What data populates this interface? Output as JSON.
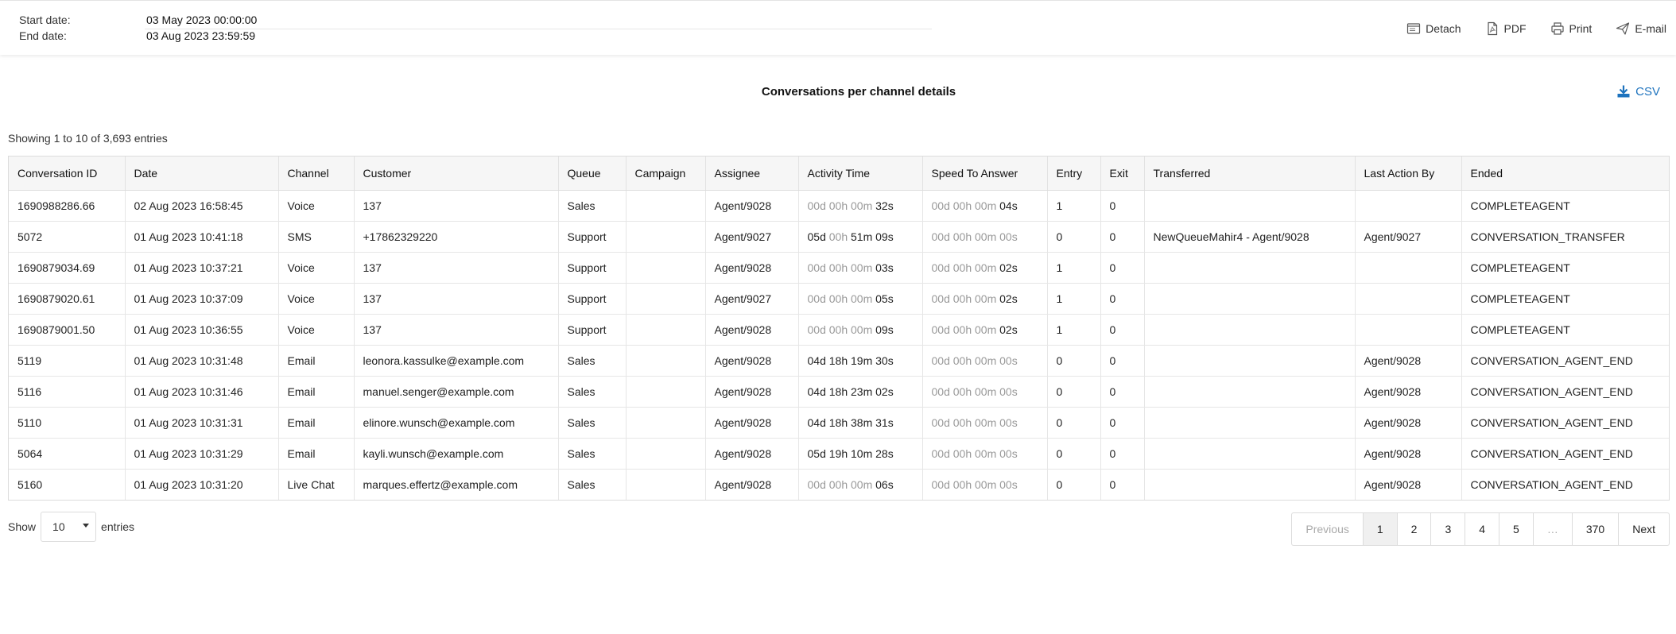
{
  "header": {
    "start_label": "Start date:",
    "start_value": "03 May 2023 00:00:00",
    "end_label": "End date:",
    "end_value": "03 Aug 2023 23:59:59",
    "actions": {
      "detach": "Detach",
      "pdf": "PDF",
      "print": "Print",
      "email": "E-mail"
    }
  },
  "report": {
    "title": "Conversations per channel details",
    "csv_label": "CSV",
    "showing": "Showing 1 to 10 of 3,693 entries"
  },
  "table": {
    "columns": [
      "Conversation ID",
      "Date",
      "Channel",
      "Customer",
      "Queue",
      "Campaign",
      "Assignee",
      "Activity Time",
      "Speed To Answer",
      "Entry",
      "Exit",
      "Transferred",
      "Last Action By",
      "Ended"
    ],
    "rows": [
      {
        "id": "1690988286.66",
        "date": "02 Aug 2023 16:58:45",
        "channel": "Voice",
        "customer": "137",
        "queue": "Sales",
        "campaign": "",
        "assignee": "Agent/9028",
        "activity_dim": "00d 00h 00m",
        "activity": "32s",
        "speed_dim": "00d 00h 00m",
        "speed": "04s",
        "entry": "1",
        "exit": "0",
        "transferred": "",
        "last_action": "",
        "ended": "COMPLETEAGENT"
      },
      {
        "id": "5072",
        "date": "01 Aug 2023 10:41:18",
        "channel": "SMS",
        "customer": "+17862329220",
        "queue": "Support",
        "campaign": "",
        "assignee": "Agent/9027",
        "activity_a": "05d",
        "activity_dim": "00h",
        "activity": "51m 09s",
        "speed_dim": "00d 00h 00m 00s",
        "speed": "",
        "entry": "0",
        "exit": "0",
        "transferred": "NewQueueMahir4 - Agent/9028",
        "last_action": "Agent/9027",
        "ended": "CONVERSATION_TRANSFER"
      },
      {
        "id": "1690879034.69",
        "date": "01 Aug 2023 10:37:21",
        "channel": "Voice",
        "customer": "137",
        "queue": "Support",
        "campaign": "",
        "assignee": "Agent/9028",
        "activity_dim": "00d 00h 00m",
        "activity": "03s",
        "speed_dim": "00d 00h 00m",
        "speed": "02s",
        "entry": "1",
        "exit": "0",
        "transferred": "",
        "last_action": "",
        "ended": "COMPLETEAGENT"
      },
      {
        "id": "1690879020.61",
        "date": "01 Aug 2023 10:37:09",
        "channel": "Voice",
        "customer": "137",
        "queue": "Support",
        "campaign": "",
        "assignee": "Agent/9027",
        "activity_dim": "00d 00h 00m",
        "activity": "05s",
        "speed_dim": "00d 00h 00m",
        "speed": "02s",
        "entry": "1",
        "exit": "0",
        "transferred": "",
        "last_action": "",
        "ended": "COMPLETEAGENT"
      },
      {
        "id": "1690879001.50",
        "date": "01 Aug 2023 10:36:55",
        "channel": "Voice",
        "customer": "137",
        "queue": "Support",
        "campaign": "",
        "assignee": "Agent/9028",
        "activity_dim": "00d 00h 00m",
        "activity": "09s",
        "speed_dim": "00d 00h 00m",
        "speed": "02s",
        "entry": "1",
        "exit": "0",
        "transferred": "",
        "last_action": "",
        "ended": "COMPLETEAGENT"
      },
      {
        "id": "5119",
        "date": "01 Aug 2023 10:31:48",
        "channel": "Email",
        "customer": "leonora.kassulke@example.com",
        "queue": "Sales",
        "campaign": "",
        "assignee": "Agent/9028",
        "activity_dim": "",
        "activity": "04d 18h 19m 30s",
        "speed_dim": "00d 00h 00m 00s",
        "speed": "",
        "entry": "0",
        "exit": "0",
        "transferred": "",
        "last_action": "Agent/9028",
        "ended": "CONVERSATION_AGENT_END"
      },
      {
        "id": "5116",
        "date": "01 Aug 2023 10:31:46",
        "channel": "Email",
        "customer": "manuel.senger@example.com",
        "queue": "Sales",
        "campaign": "",
        "assignee": "Agent/9028",
        "activity_dim": "",
        "activity": "04d 18h 23m 02s",
        "speed_dim": "00d 00h 00m 00s",
        "speed": "",
        "entry": "0",
        "exit": "0",
        "transferred": "",
        "last_action": "Agent/9028",
        "ended": "CONVERSATION_AGENT_END"
      },
      {
        "id": "5110",
        "date": "01 Aug 2023 10:31:31",
        "channel": "Email",
        "customer": "elinore.wunsch@example.com",
        "queue": "Sales",
        "campaign": "",
        "assignee": "Agent/9028",
        "activity_dim": "",
        "activity": "04d 18h 38m 31s",
        "speed_dim": "00d 00h 00m 00s",
        "speed": "",
        "entry": "0",
        "exit": "0",
        "transferred": "",
        "last_action": "Agent/9028",
        "ended": "CONVERSATION_AGENT_END"
      },
      {
        "id": "5064",
        "date": "01 Aug 2023 10:31:29",
        "channel": "Email",
        "customer": "kayli.wunsch@example.com",
        "queue": "Sales",
        "campaign": "",
        "assignee": "Agent/9028",
        "activity_dim": "",
        "activity": "05d 19h 10m 28s",
        "speed_dim": "00d 00h 00m 00s",
        "speed": "",
        "entry": "0",
        "exit": "0",
        "transferred": "",
        "last_action": "Agent/9028",
        "ended": "CONVERSATION_AGENT_END"
      },
      {
        "id": "5160",
        "date": "01 Aug 2023 10:31:20",
        "channel": "Live Chat",
        "customer": "marques.effertz@example.com",
        "queue": "Sales",
        "campaign": "",
        "assignee": "Agent/9028",
        "activity_dim": "00d 00h 00m",
        "activity": "06s",
        "speed_dim": "00d 00h 00m 00s",
        "speed": "",
        "entry": "0",
        "exit": "0",
        "transferred": "",
        "last_action": "Agent/9028",
        "ended": "CONVERSATION_AGENT_END"
      }
    ]
  },
  "footer": {
    "show_label": "Show",
    "page_size": "10",
    "entries_label": "entries",
    "pagination": {
      "previous": "Previous",
      "pages": [
        "1",
        "2",
        "3",
        "4",
        "5"
      ],
      "ellipsis": "…",
      "last": "370",
      "next": "Next",
      "current": "1"
    }
  },
  "colors": {
    "accent": "#1e73be",
    "muted": "#999999"
  }
}
